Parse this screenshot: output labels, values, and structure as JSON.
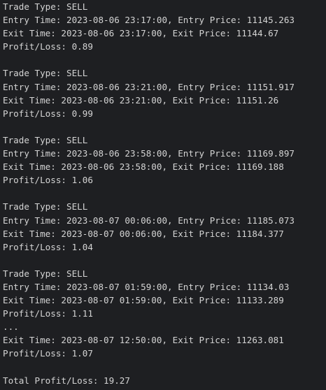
{
  "output": {
    "lines": [
      "Trade Type: SELL",
      "Entry Time: 2023-08-06 23:17:00, Entry Price: 11145.263",
      "Exit Time: 2023-08-06 23:17:00, Exit Price: 11144.67",
      "Profit/Loss: 0.89",
      "",
      "Trade Type: SELL",
      "Entry Time: 2023-08-06 23:21:00, Entry Price: 11151.917",
      "Exit Time: 2023-08-06 23:21:00, Exit Price: 11151.26",
      "Profit/Loss: 0.99",
      "",
      "Trade Type: SELL",
      "Entry Time: 2023-08-06 23:58:00, Entry Price: 11169.897",
      "Exit Time: 2023-08-06 23:58:00, Exit Price: 11169.188",
      "Profit/Loss: 1.06",
      "",
      "Trade Type: SELL",
      "Entry Time: 2023-08-07 00:06:00, Entry Price: 11185.073",
      "Exit Time: 2023-08-07 00:06:00, Exit Price: 11184.377",
      "Profit/Loss: 1.04",
      "",
      "Trade Type: SELL",
      "Entry Time: 2023-08-07 01:59:00, Entry Price: 11134.03",
      "Exit Time: 2023-08-07 01:59:00, Exit Price: 11133.289",
      "Profit/Loss: 1.11",
      "...",
      "Exit Time: 2023-08-07 12:50:00, Exit Price: 11263.081",
      "Profit/Loss: 1.07",
      "",
      "Total Profit/Loss: 19.27"
    ]
  }
}
